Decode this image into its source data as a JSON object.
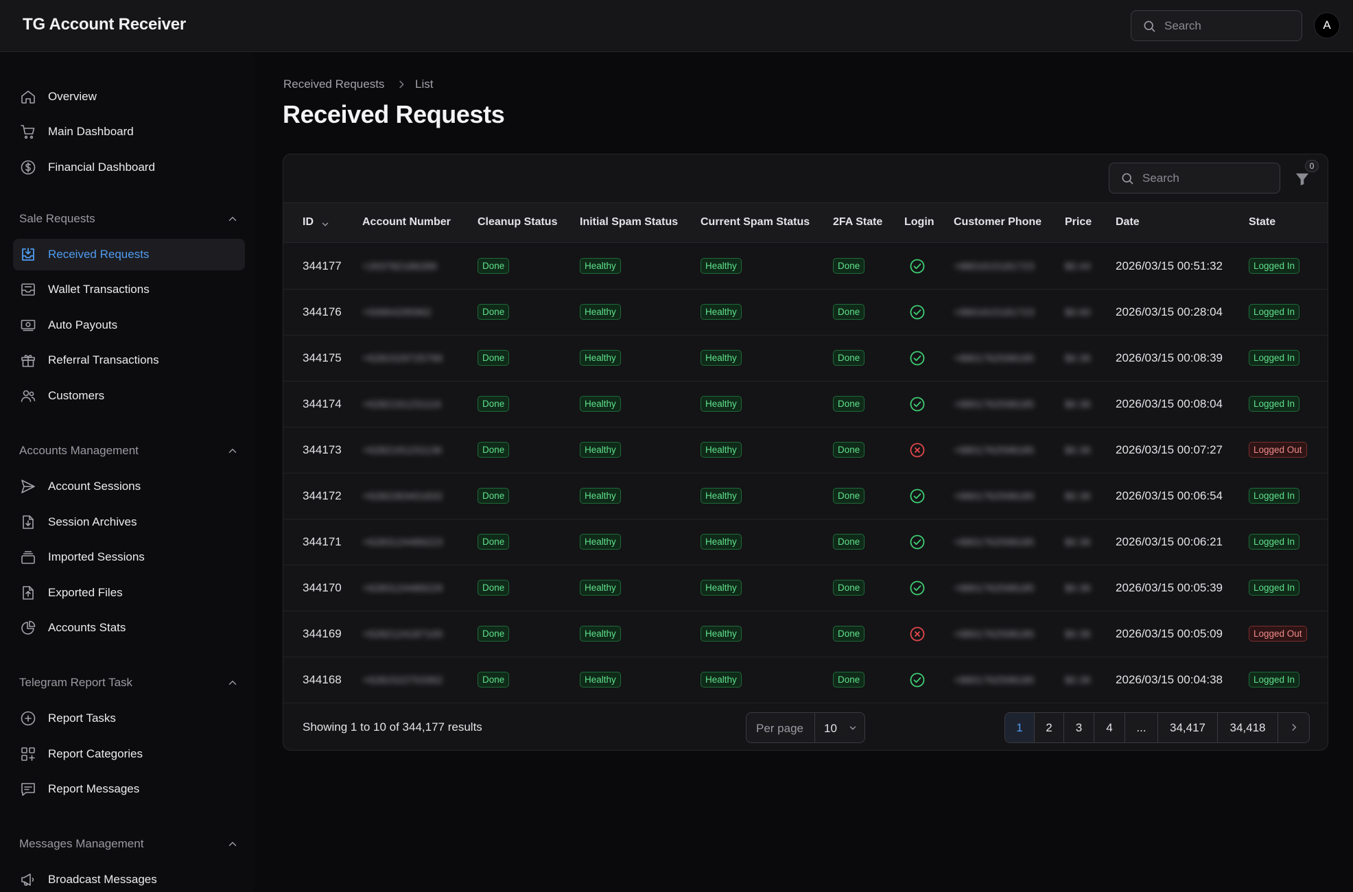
{
  "app": {
    "title": "TG Account Receiver"
  },
  "topbar": {
    "search_placeholder": "Search",
    "avatar_letter": "A"
  },
  "sidebar": {
    "items_top": [
      "Overview",
      "Main Dashboard",
      "Financial Dashboard"
    ],
    "groups": [
      {
        "label": "Sale Requests",
        "items": [
          "Received Requests",
          "Wallet Transactions",
          "Auto Payouts",
          "Referral Transactions",
          "Customers"
        ]
      },
      {
        "label": "Accounts Management",
        "items": [
          "Account Sessions",
          "Session Archives",
          "Imported Sessions",
          "Exported Files",
          "Accounts Stats"
        ]
      },
      {
        "label": "Telegram Report Task",
        "items": [
          "Report Tasks",
          "Report Categories",
          "Report Messages"
        ]
      },
      {
        "label": "Messages Management",
        "items": [
          "Broadcast Messages"
        ]
      }
    ],
    "active_item": "Received Requests"
  },
  "breadcrumb": {
    "parent": "Received Requests",
    "current": "List"
  },
  "page_title": "Received Requests",
  "table": {
    "search_placeholder": "Search",
    "filter_count": "0",
    "columns": [
      "ID",
      "Account Number",
      "Cleanup Status",
      "Initial Spam Status",
      "Current Spam Status",
      "2FA State",
      "Login",
      "Customer Phone",
      "Price",
      "Date",
      "State"
    ],
    "rows": [
      {
        "id": "344177",
        "account": "+263782186289",
        "cleanup": "Done",
        "initial_spam": "Healthy",
        "current_spam": "Healthy",
        "twofa": "Done",
        "login": "ok",
        "phone": "+8801615181723",
        "price": "$0.44",
        "date": "2026/03/15 00:51:32",
        "state": "Logged In"
      },
      {
        "id": "344176",
        "account": "+50664295962",
        "cleanup": "Done",
        "initial_spam": "Healthy",
        "current_spam": "Healthy",
        "twofa": "Done",
        "login": "ok",
        "phone": "+8801615181723",
        "price": "$0.60",
        "date": "2026/03/15 00:28:04",
        "state": "Logged In"
      },
      {
        "id": "344175",
        "account": "+6281529725796",
        "cleanup": "Done",
        "initial_spam": "Healthy",
        "current_spam": "Healthy",
        "twofa": "Done",
        "login": "ok",
        "phone": "+8801762598185",
        "price": "$0.36",
        "date": "2026/03/15 00:08:39",
        "state": "Logged In"
      },
      {
        "id": "344174",
        "account": "+6282191231116",
        "cleanup": "Done",
        "initial_spam": "Healthy",
        "current_spam": "Healthy",
        "twofa": "Done",
        "login": "ok",
        "phone": "+8801762598185",
        "price": "$0.36",
        "date": "2026/03/15 00:08:04",
        "state": "Logged In"
      },
      {
        "id": "344173",
        "account": "+6282191231136",
        "cleanup": "Done",
        "initial_spam": "Healthy",
        "current_spam": "Healthy",
        "twofa": "Done",
        "login": "fail",
        "phone": "+8801762598185",
        "price": "$0.36",
        "date": "2026/03/15 00:07:27",
        "state": "Logged Out"
      },
      {
        "id": "344172",
        "account": "+6282283401832",
        "cleanup": "Done",
        "initial_spam": "Healthy",
        "current_spam": "Healthy",
        "twofa": "Done",
        "login": "ok",
        "phone": "+8801762598185",
        "price": "$0.36",
        "date": "2026/03/15 00:06:54",
        "state": "Logged In"
      },
      {
        "id": "344171",
        "account": "+6283124489223",
        "cleanup": "Done",
        "initial_spam": "Healthy",
        "current_spam": "Healthy",
        "twofa": "Done",
        "login": "ok",
        "phone": "+8801762598185",
        "price": "$0.36",
        "date": "2026/03/15 00:06:21",
        "state": "Logged In"
      },
      {
        "id": "344170",
        "account": "+6283124489229",
        "cleanup": "Done",
        "initial_spam": "Healthy",
        "current_spam": "Healthy",
        "twofa": "Done",
        "login": "ok",
        "phone": "+8801762598185",
        "price": "$0.36",
        "date": "2026/03/15 00:05:39",
        "state": "Logged In"
      },
      {
        "id": "344169",
        "account": "+6282124187100",
        "cleanup": "Done",
        "initial_spam": "Healthy",
        "current_spam": "Healthy",
        "twofa": "Done",
        "login": "fail",
        "phone": "+8801762598185",
        "price": "$0.36",
        "date": "2026/03/15 00:05:09",
        "state": "Logged Out"
      },
      {
        "id": "344168",
        "account": "+6281522753362",
        "cleanup": "Done",
        "initial_spam": "Healthy",
        "current_spam": "Healthy",
        "twofa": "Done",
        "login": "ok",
        "phone": "+8801762598185",
        "price": "$0.36",
        "date": "2026/03/15 00:04:38",
        "state": "Logged In"
      }
    ]
  },
  "footer": {
    "showing": "Showing 1 to 10 of 344,177 results",
    "per_page_label": "Per page",
    "per_page_value": "10",
    "pages": [
      "1",
      "2",
      "3",
      "4",
      "...",
      "34,417",
      "34,418"
    ],
    "current_page": "1"
  },
  "colors": {
    "accent": "#4f9cf0",
    "success": "#5fe08b",
    "danger": "#f08a8a",
    "background": "#0a0a0c"
  }
}
